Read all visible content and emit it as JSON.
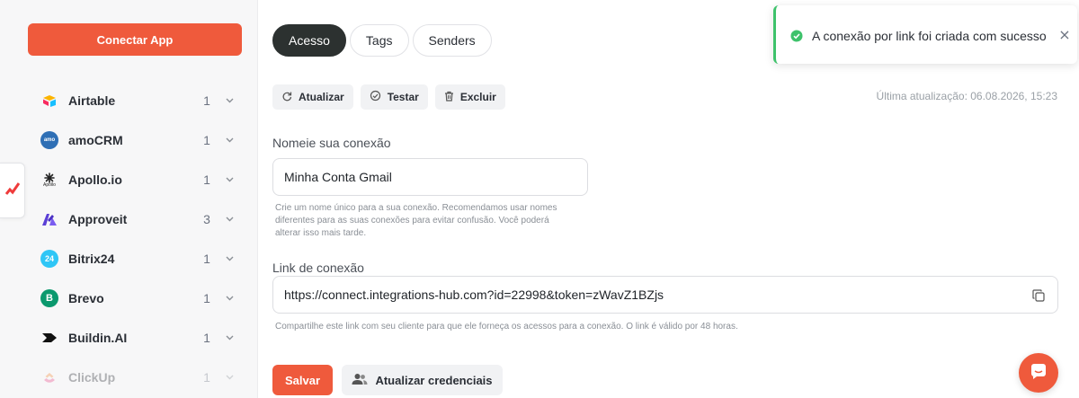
{
  "sidebar": {
    "connect_label": "Conectar App",
    "apps": [
      {
        "name": "Airtable",
        "count": "1"
      },
      {
        "name": "amoCRM",
        "count": "1"
      },
      {
        "name": "Apollo.io",
        "count": "1"
      },
      {
        "name": "Approveit",
        "count": "3"
      },
      {
        "name": "Bitrix24",
        "count": "1"
      },
      {
        "name": "Brevo",
        "count": "1"
      },
      {
        "name": "Buildin.AI",
        "count": "1"
      },
      {
        "name": "ClickUp",
        "count": "1"
      }
    ],
    "icon_labels": {
      "amocrm": "amo",
      "apollo": "Apollo",
      "bitrix": "24",
      "brevo": "B"
    }
  },
  "tabs": [
    "Acesso",
    "Tags",
    "Senders"
  ],
  "toolbar": {
    "refresh": "Atualizar",
    "test": "Testar",
    "delete": "Excluir"
  },
  "last_update": "Última atualização: 06.08.2026, 15:23",
  "name_field": {
    "label": "Nomeie sua conexão",
    "value": "Minha Conta Gmail",
    "help_lines": [
      "Crie um nome único para a sua conexão. Recomendamos usar nomes",
      "diferentes para as suas conexões para evitar confusão. Você poderá",
      "alterar isso mais tarde."
    ]
  },
  "link_field": {
    "label": "Link de conexão",
    "value": "https://connect.integrations-hub.com?id=22998&token=zWavZ1BZjs",
    "help": "Compartilhe este link com seu cliente para que ele forneça os acessos para a conexão. O link é válido por 48 horas."
  },
  "actions": {
    "save": "Salvar",
    "update_credentials": "Atualizar credenciais"
  },
  "toast": {
    "message": "A conexão por link foi criada com sucesso",
    "close": "×"
  },
  "colors": {
    "accent": "#ef5a3c",
    "active_tab": "#2c3130",
    "success": "#3ec26b"
  }
}
